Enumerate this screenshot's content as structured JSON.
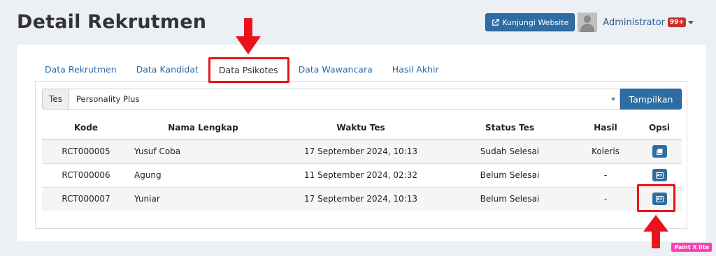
{
  "page": {
    "title": "Detail Rekrutmen"
  },
  "topbar": {
    "visit_button": "Kunjungi Website",
    "user_name": "Administrator",
    "notification_badge": "99+"
  },
  "tabs": [
    {
      "label": "Data Rekrutmen"
    },
    {
      "label": "Data Kandidat"
    },
    {
      "label": "Data Psikotes",
      "active": true
    },
    {
      "label": "Data Wawancara"
    },
    {
      "label": "Hasil Akhir"
    }
  ],
  "filter": {
    "addon_label": "Tes",
    "selected_test": "Personality Plus",
    "submit_label": "Tampilkan"
  },
  "table": {
    "headers": [
      "Kode",
      "Nama Lengkap",
      "Waktu Tes",
      "Status Tes",
      "Hasil",
      "Opsi"
    ],
    "rows": [
      {
        "code": "RCT000005",
        "name": "Yusuf Coba",
        "time": "17 September 2024, 10:13",
        "status": "Sudah Selesai",
        "result": "Koleris",
        "action_icon": "book-icon"
      },
      {
        "code": "RCT000006",
        "name": "Agung",
        "time": "11 September 2024, 02:32",
        "status": "Belum Selesai",
        "result": "-",
        "action_icon": "id-card-icon"
      },
      {
        "code": "RCT000007",
        "name": "Yuniar",
        "time": "17 September 2024, 10:13",
        "status": "Belum Selesai",
        "result": "-",
        "action_icon": "id-card-icon"
      }
    ]
  },
  "annotations": {
    "highlight_color": "#e8141a"
  },
  "watermark": "Paint X lite",
  "colors": {
    "primary": "#2e6da4",
    "link": "#2b6aa3",
    "badge": "#c9302c"
  }
}
